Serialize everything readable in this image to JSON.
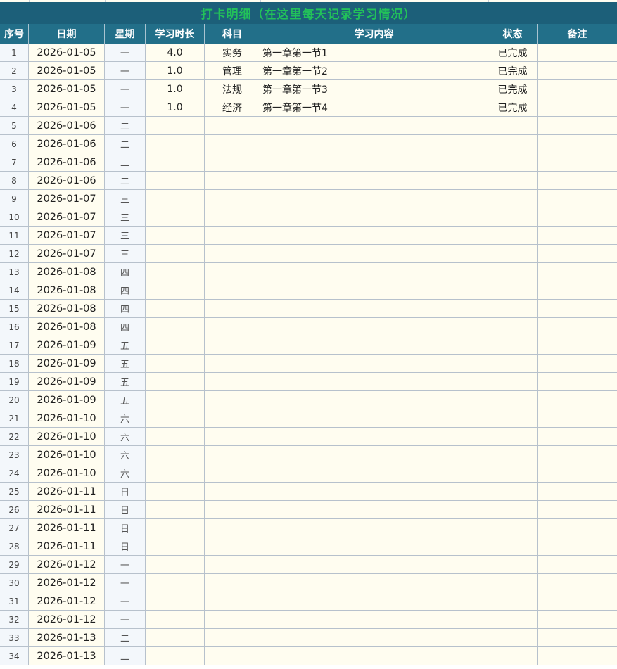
{
  "sheet": {
    "title": "打卡明细（在这里每天记录学习情况）",
    "headers": {
      "seq": "序号",
      "date": "日期",
      "weekday": "星期",
      "duration": "学习时长",
      "subject": "科目",
      "content": "学习内容",
      "status": "状态",
      "note": "备注"
    },
    "rows": [
      {
        "seq": "1",
        "date": "2026-01-05",
        "weekday": "一",
        "duration": "4.0",
        "subject": "实务",
        "content": "第一章第一节1",
        "status": "已完成",
        "note": ""
      },
      {
        "seq": "2",
        "date": "2026-01-05",
        "weekday": "一",
        "duration": "1.0",
        "subject": "管理",
        "content": "第一章第一节2",
        "status": "已完成",
        "note": ""
      },
      {
        "seq": "3",
        "date": "2026-01-05",
        "weekday": "一",
        "duration": "1.0",
        "subject": "法规",
        "content": "第一章第一节3",
        "status": "已完成",
        "note": ""
      },
      {
        "seq": "4",
        "date": "2026-01-05",
        "weekday": "一",
        "duration": "1.0",
        "subject": "经济",
        "content": "第一章第一节4",
        "status": "已完成",
        "note": ""
      },
      {
        "seq": "5",
        "date": "2026-01-06",
        "weekday": "二",
        "duration": "",
        "subject": "",
        "content": "",
        "status": "",
        "note": ""
      },
      {
        "seq": "6",
        "date": "2026-01-06",
        "weekday": "二",
        "duration": "",
        "subject": "",
        "content": "",
        "status": "",
        "note": ""
      },
      {
        "seq": "7",
        "date": "2026-01-06",
        "weekday": "二",
        "duration": "",
        "subject": "",
        "content": "",
        "status": "",
        "note": ""
      },
      {
        "seq": "8",
        "date": "2026-01-06",
        "weekday": "二",
        "duration": "",
        "subject": "",
        "content": "",
        "status": "",
        "note": ""
      },
      {
        "seq": "9",
        "date": "2026-01-07",
        "weekday": "三",
        "duration": "",
        "subject": "",
        "content": "",
        "status": "",
        "note": ""
      },
      {
        "seq": "10",
        "date": "2026-01-07",
        "weekday": "三",
        "duration": "",
        "subject": "",
        "content": "",
        "status": "",
        "note": ""
      },
      {
        "seq": "11",
        "date": "2026-01-07",
        "weekday": "三",
        "duration": "",
        "subject": "",
        "content": "",
        "status": "",
        "note": ""
      },
      {
        "seq": "12",
        "date": "2026-01-07",
        "weekday": "三",
        "duration": "",
        "subject": "",
        "content": "",
        "status": "",
        "note": ""
      },
      {
        "seq": "13",
        "date": "2026-01-08",
        "weekday": "四",
        "duration": "",
        "subject": "",
        "content": "",
        "status": "",
        "note": ""
      },
      {
        "seq": "14",
        "date": "2026-01-08",
        "weekday": "四",
        "duration": "",
        "subject": "",
        "content": "",
        "status": "",
        "note": ""
      },
      {
        "seq": "15",
        "date": "2026-01-08",
        "weekday": "四",
        "duration": "",
        "subject": "",
        "content": "",
        "status": "",
        "note": ""
      },
      {
        "seq": "16",
        "date": "2026-01-08",
        "weekday": "四",
        "duration": "",
        "subject": "",
        "content": "",
        "status": "",
        "note": ""
      },
      {
        "seq": "17",
        "date": "2026-01-09",
        "weekday": "五",
        "duration": "",
        "subject": "",
        "content": "",
        "status": "",
        "note": ""
      },
      {
        "seq": "18",
        "date": "2026-01-09",
        "weekday": "五",
        "duration": "",
        "subject": "",
        "content": "",
        "status": "",
        "note": ""
      },
      {
        "seq": "19",
        "date": "2026-01-09",
        "weekday": "五",
        "duration": "",
        "subject": "",
        "content": "",
        "status": "",
        "note": ""
      },
      {
        "seq": "20",
        "date": "2026-01-09",
        "weekday": "五",
        "duration": "",
        "subject": "",
        "content": "",
        "status": "",
        "note": ""
      },
      {
        "seq": "21",
        "date": "2026-01-10",
        "weekday": "六",
        "duration": "",
        "subject": "",
        "content": "",
        "status": "",
        "note": ""
      },
      {
        "seq": "22",
        "date": "2026-01-10",
        "weekday": "六",
        "duration": "",
        "subject": "",
        "content": "",
        "status": "",
        "note": ""
      },
      {
        "seq": "23",
        "date": "2026-01-10",
        "weekday": "六",
        "duration": "",
        "subject": "",
        "content": "",
        "status": "",
        "note": ""
      },
      {
        "seq": "24",
        "date": "2026-01-10",
        "weekday": "六",
        "duration": "",
        "subject": "",
        "content": "",
        "status": "",
        "note": ""
      },
      {
        "seq": "25",
        "date": "2026-01-11",
        "weekday": "日",
        "duration": "",
        "subject": "",
        "content": "",
        "status": "",
        "note": ""
      },
      {
        "seq": "26",
        "date": "2026-01-11",
        "weekday": "日",
        "duration": "",
        "subject": "",
        "content": "",
        "status": "",
        "note": ""
      },
      {
        "seq": "27",
        "date": "2026-01-11",
        "weekday": "日",
        "duration": "",
        "subject": "",
        "content": "",
        "status": "",
        "note": ""
      },
      {
        "seq": "28",
        "date": "2026-01-11",
        "weekday": "日",
        "duration": "",
        "subject": "",
        "content": "",
        "status": "",
        "note": ""
      },
      {
        "seq": "29",
        "date": "2026-01-12",
        "weekday": "一",
        "duration": "",
        "subject": "",
        "content": "",
        "status": "",
        "note": ""
      },
      {
        "seq": "30",
        "date": "2026-01-12",
        "weekday": "一",
        "duration": "",
        "subject": "",
        "content": "",
        "status": "",
        "note": ""
      },
      {
        "seq": "31",
        "date": "2026-01-12",
        "weekday": "一",
        "duration": "",
        "subject": "",
        "content": "",
        "status": "",
        "note": ""
      },
      {
        "seq": "32",
        "date": "2026-01-12",
        "weekday": "一",
        "duration": "",
        "subject": "",
        "content": "",
        "status": "",
        "note": ""
      },
      {
        "seq": "33",
        "date": "2026-01-13",
        "weekday": "二",
        "duration": "",
        "subject": "",
        "content": "",
        "status": "",
        "note": ""
      },
      {
        "seq": "34",
        "date": "2026-01-13",
        "weekday": "二",
        "duration": "",
        "subject": "",
        "content": "",
        "status": "",
        "note": ""
      }
    ]
  },
  "colors": {
    "title_bg": "#1c5f79",
    "title_text": "#22c15a",
    "header_bg": "#226f89",
    "cell_bg": "#fffdf0",
    "index_col_bg": "#f3f7fb",
    "grid_line": "#b7c1cc"
  }
}
